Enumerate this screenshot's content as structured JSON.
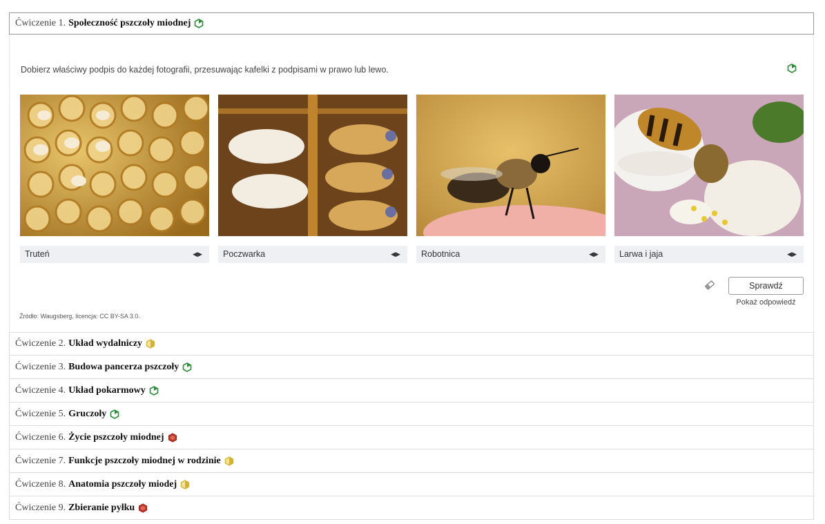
{
  "exercises": [
    {
      "number": "Ćwiczenie 1.",
      "title": "Społeczność pszczoły miodnej",
      "status": "green"
    },
    {
      "number": "Ćwiczenie 2.",
      "title": "Układ wydalniczy",
      "status": "yellow"
    },
    {
      "number": "Ćwiczenie 3.",
      "title": "Budowa pancerza pszczoły",
      "status": "green"
    },
    {
      "number": "Ćwiczenie 4.",
      "title": "Układ pokarmowy",
      "status": "green"
    },
    {
      "number": "Ćwiczenie 5.",
      "title": "Gruczoły",
      "status": "green"
    },
    {
      "number": "Ćwiczenie 6.",
      "title": "Życie pszczoły miodnej",
      "status": "red"
    },
    {
      "number": "Ćwiczenie 7.",
      "title": "Funkcje pszczoły miodnej w rodzinie",
      "status": "yellow"
    },
    {
      "number": "Ćwiczenie 8.",
      "title": "Anatomia pszczoły miodej",
      "status": "yellow"
    },
    {
      "number": "Ćwiczenie 9.",
      "title": "Zbieranie pyłku",
      "status": "red"
    }
  ],
  "exercise1": {
    "instruction": "Dobierz właściwy podpis do każdej fotografii, przesuwając kafelki z podpisami w prawo lub lewo.",
    "tiles": [
      "Truteń",
      "Poczwarka",
      "Robotnica",
      "Larwa i jaja"
    ],
    "photos": [
      "honeycomb-larvae-photo",
      "pupae-photo",
      "worker-bee-on-finger-photo",
      "bee-on-flower-photo"
    ],
    "check_label": "Sprawdź",
    "show_answer_label": "Pokaż odpowiedź",
    "source": "Źródło: Waugsberg, licencja: CC BY-SA 3.0."
  },
  "colors": {
    "green": "#2e8b3a",
    "yellow": "#d4b233",
    "red": "#c0392b",
    "tile_bg": "#eef0f3"
  }
}
